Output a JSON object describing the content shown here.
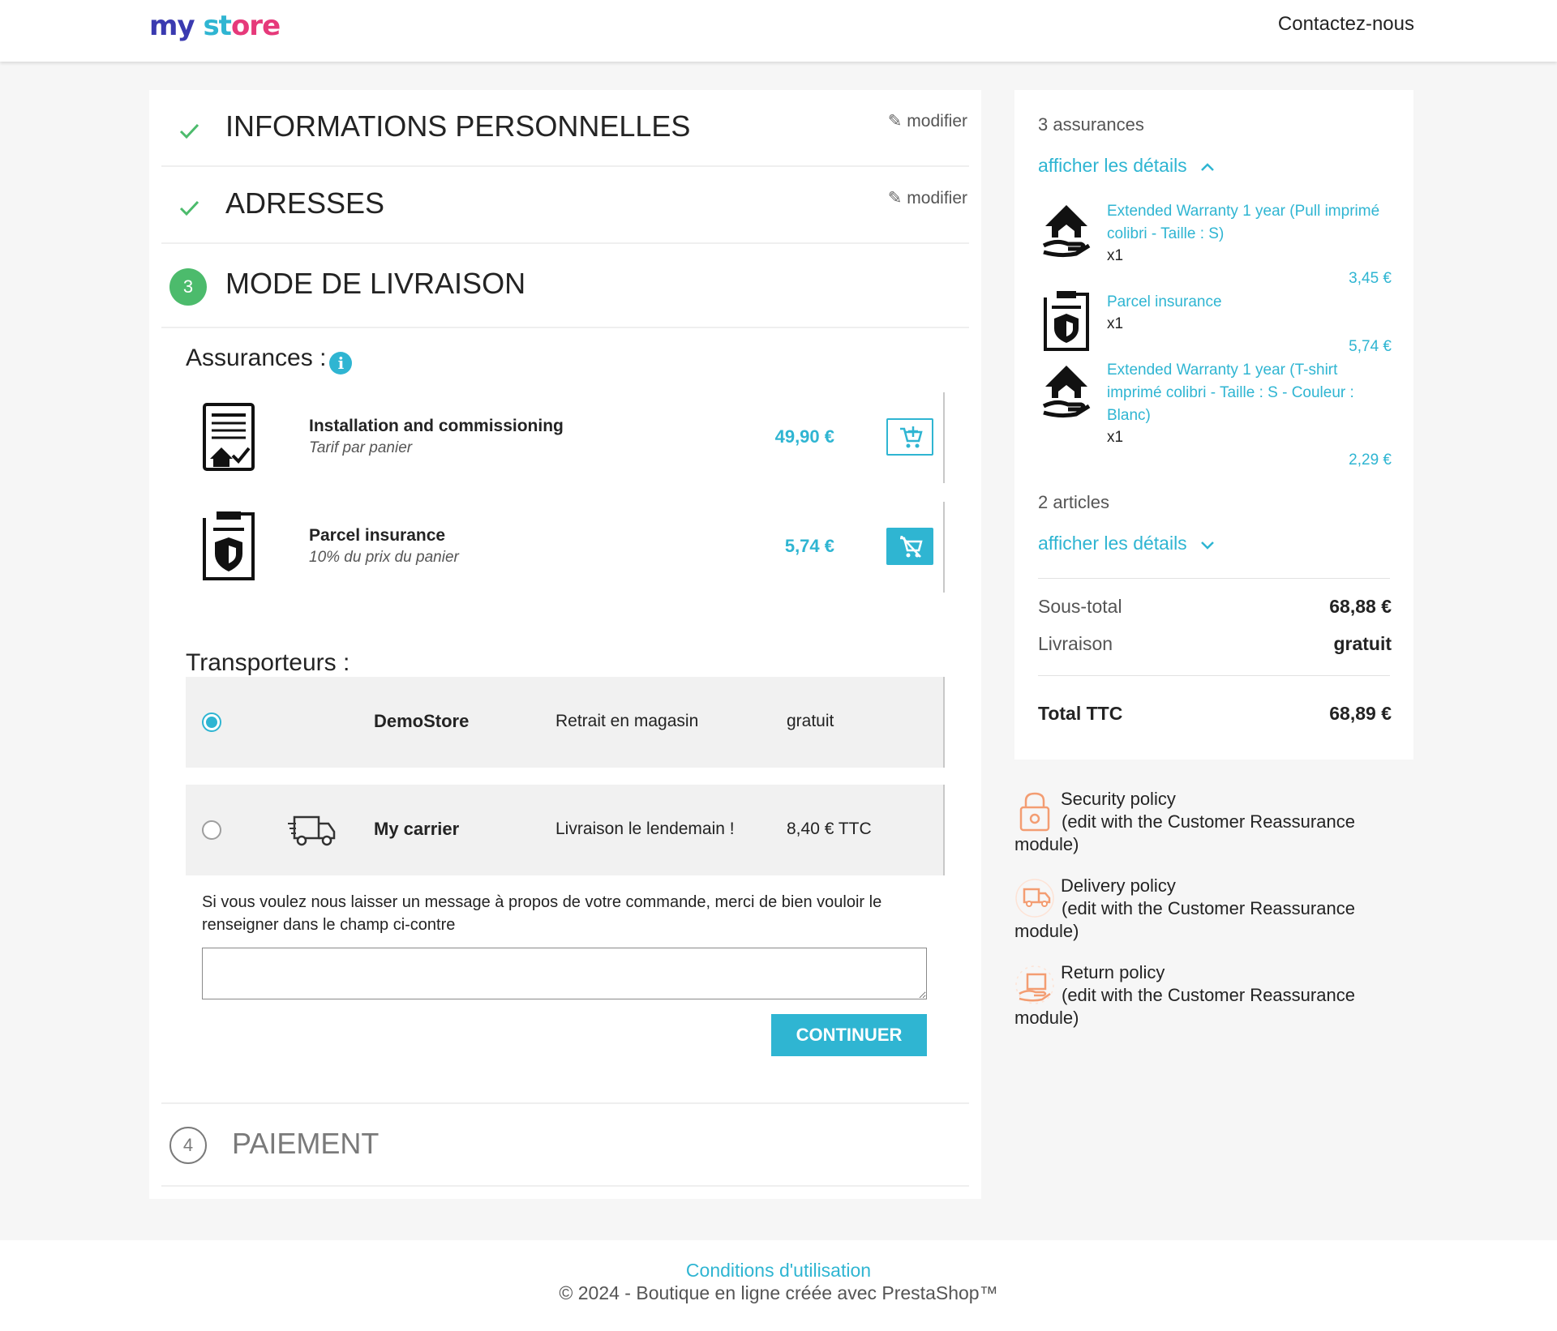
{
  "header": {
    "logo": {
      "part1": "my",
      "part2": "st",
      "part3": "ore"
    },
    "contact_label": "Contactez-nous"
  },
  "steps": {
    "personal": {
      "title": "INFORMATIONS PERSONNELLES",
      "modify": "modifier"
    },
    "addresses": {
      "title": "ADRESSES",
      "modify": "modifier"
    },
    "delivery": {
      "number": "3",
      "title": "MODE DE LIVRAISON"
    },
    "payment": {
      "number": "4",
      "title": "PAIEMENT"
    }
  },
  "insurances": {
    "heading": "Assurances :",
    "info_icon": "i",
    "items": [
      {
        "name": "Installation and commissioning",
        "desc": "Tarif par panier",
        "price": "49,90 €",
        "icon": "document-house-icon",
        "button": "add-to-cart"
      },
      {
        "name": "Parcel insurance",
        "desc": "10% du prix du panier",
        "price": "5,74 €",
        "icon": "document-shield-icon",
        "button": "remove-from-cart"
      }
    ]
  },
  "carriers": {
    "heading": "Transporteurs :",
    "items": [
      {
        "name": "DemoStore",
        "delay": "Retrait en magasin",
        "price": "gratuit",
        "selected": true
      },
      {
        "name": "My carrier",
        "delay": "Livraison le lendemain !",
        "price": "8,40 € TTC",
        "selected": false
      }
    ]
  },
  "message": {
    "label": "Si vous voulez nous laisser un message à propos de votre commande, merci de bien vouloir le renseigner dans le champ ci-contre",
    "value": ""
  },
  "continue_label": "CONTINUER",
  "summary": {
    "insurances_count": "3 assurances",
    "show_details_1": "afficher les détails",
    "insurance_items": [
      {
        "name": "Extended Warranty 1 year (Pull imprimé colibri - Taille : S)",
        "qty": "x1",
        "price": "3,45 €"
      },
      {
        "name": "Parcel insurance",
        "qty": "x1",
        "price": "5,74 €"
      },
      {
        "name": "Extended Warranty 1 year (T-shirt imprimé colibri - Taille : S - Couleur : Blanc)",
        "qty": "x1",
        "price": "2,29 €"
      }
    ],
    "articles_count": "2 articles",
    "show_details_2": "afficher les détails",
    "subtotal_label": "Sous-total",
    "subtotal_value": "68,88 €",
    "shipping_label": "Livraison",
    "shipping_value": "gratuit",
    "total_label": "Total TTC",
    "total_value": "68,89 €"
  },
  "reassurance": [
    {
      "title": "Security policy",
      "desc": "(edit with the Customer Reassurance module)",
      "icon": "lock-icon"
    },
    {
      "title": "Delivery policy",
      "desc": "(edit with the Customer Reassurance module)",
      "icon": "truck-icon"
    },
    {
      "title": "Return policy",
      "desc": "(edit with the Customer Reassurance module)",
      "icon": "return-package-icon"
    }
  ],
  "footer": {
    "terms_link": "Conditions d'utilisation",
    "copyright": "© 2024 - Boutique en ligne créée avec PrestaShop™"
  },
  "colors": {
    "accent": "#2fb5d2",
    "success": "#4cbb6c",
    "reassurance": "#f39d72"
  }
}
